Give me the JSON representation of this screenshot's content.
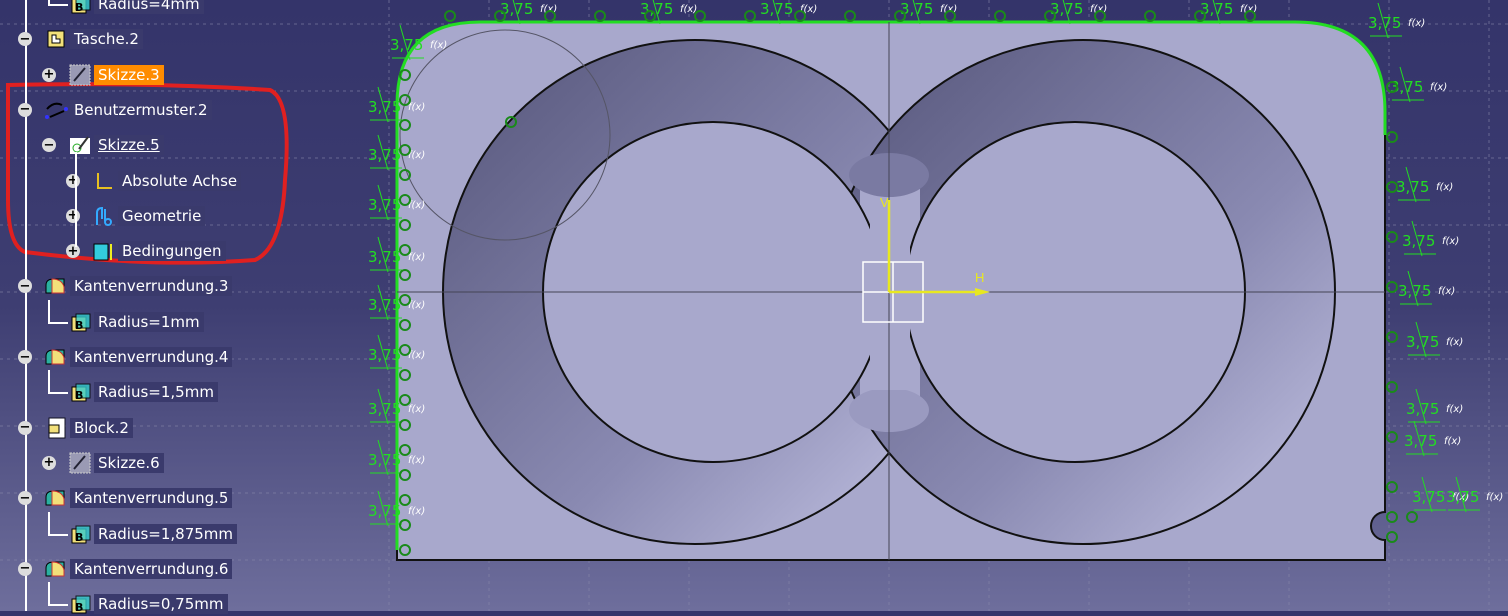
{
  "tree": {
    "items": [
      {
        "label": "Radius=4mm",
        "type": "parameter"
      },
      {
        "label": "Tasche.2",
        "type": "pocket"
      },
      {
        "label": "Skizze.3",
        "type": "sketch",
        "selected": true
      },
      {
        "label": "Benutzermuster.2",
        "type": "user-pattern"
      },
      {
        "label": "Skizze.5",
        "type": "sketch-active"
      },
      {
        "label": "Absolute Achse",
        "type": "axis"
      },
      {
        "label": "Geometrie",
        "type": "geometry"
      },
      {
        "label": "Bedingungen",
        "type": "constraints"
      },
      {
        "label": "Kantenverrundung.3",
        "type": "edge-fillet"
      },
      {
        "label": "Radius=1mm",
        "type": "parameter"
      },
      {
        "label": "Kantenverrundung.4",
        "type": "edge-fillet"
      },
      {
        "label": "Radius=1,5mm",
        "type": "parameter"
      },
      {
        "label": "Block.2",
        "type": "pad"
      },
      {
        "label": "Skizze.6",
        "type": "sketch"
      },
      {
        "label": "Kantenverrundung.5",
        "type": "edge-fillet"
      },
      {
        "label": "Radius=1,875mm",
        "type": "parameter"
      },
      {
        "label": "Kantenverrundung.6",
        "type": "edge-fillet"
      },
      {
        "label": "Radius=0,75mm",
        "type": "parameter"
      }
    ]
  },
  "sketch": {
    "dimension_value": "3,75",
    "formula_label": "f(x)",
    "axis_v": "V",
    "axis_h": "H"
  },
  "colors": {
    "constraint": "#22dd22",
    "selection": "#ff8c00",
    "annotation": "#e02020",
    "axis": "#e8e820",
    "plate": "#a8a8cc"
  }
}
